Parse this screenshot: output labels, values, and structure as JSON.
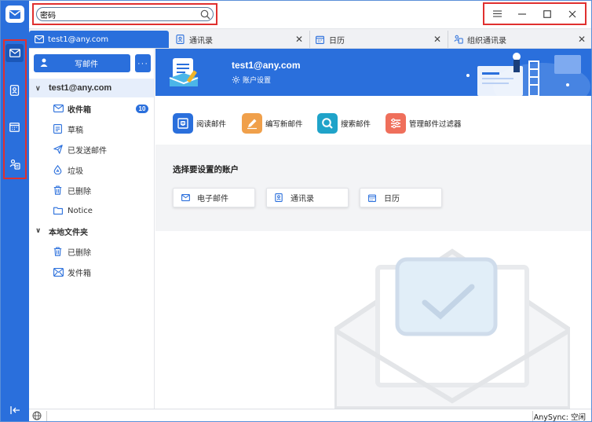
{
  "search": {
    "value": "密码"
  },
  "tabs": [
    {
      "label": "test1@any.com",
      "icon": "mail-icon",
      "active": true
    },
    {
      "label": "通讯录",
      "icon": "contacts-icon",
      "active": false
    },
    {
      "label": "日历",
      "icon": "calendar-icon",
      "active": false
    },
    {
      "label": "组织通讯录",
      "icon": "org-contacts-icon",
      "active": false
    }
  ],
  "sidebar": {
    "compose_label": "写邮件",
    "more_label": "···",
    "account_label": "test1@any.com",
    "folders": [
      {
        "label": "收件箱",
        "icon": "inbox-icon",
        "badge": "10"
      },
      {
        "label": "草稿",
        "icon": "draft-icon"
      },
      {
        "label": "已发送邮件",
        "icon": "sent-icon"
      },
      {
        "label": "垃圾",
        "icon": "junk-icon"
      },
      {
        "label": "已删除",
        "icon": "trash-icon"
      },
      {
        "label": "Notice",
        "icon": "folder-icon"
      }
    ],
    "local_label": "本地文件夹",
    "local_folders": [
      {
        "label": "已删除",
        "icon": "trash-icon"
      },
      {
        "label": "发件箱",
        "icon": "outbox-icon"
      }
    ]
  },
  "hero": {
    "email": "test1@any.com",
    "settings_label": "账户设置"
  },
  "actions": [
    {
      "label": "阅读邮件",
      "icon": "read-mail-icon",
      "color": "#2a6fdc"
    },
    {
      "label": "编写新邮件",
      "icon": "compose-icon",
      "color": "#f0a04b"
    },
    {
      "label": "搜索邮件",
      "icon": "search-mail-icon",
      "color": "#1fa3c9"
    },
    {
      "label": "管理邮件过滤器",
      "icon": "filter-icon",
      "color": "#ef6f5b"
    }
  ],
  "setup": {
    "title": "选择要设置的账户",
    "buttons": [
      {
        "label": "电子邮件",
        "icon": "mail-icon"
      },
      {
        "label": "通讯录",
        "icon": "contacts-icon"
      },
      {
        "label": "日历",
        "icon": "calendar-icon"
      }
    ]
  },
  "status": {
    "sync_text": "AnySync: 空闲"
  },
  "colors": {
    "accent": "#2a6fdc",
    "highlight_box": "#e0302f"
  }
}
